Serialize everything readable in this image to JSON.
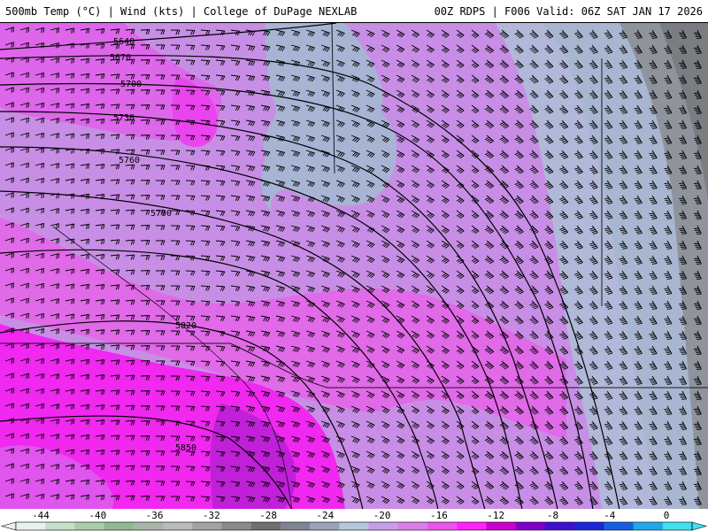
{
  "header": {
    "left_title": "500mb Temp (°C) | Wind (kts) | College of DuPage NEXLAB",
    "right_title": "00Z RDPS | F006 Valid: 06Z SAT JAN 17 2026"
  },
  "map": {
    "variable": "500mb Temp (°C)",
    "overlay": "Wind (kts)",
    "height_contour_labels": [
      "5640",
      "5670",
      "5700",
      "5730",
      "5760",
      "5790",
      "5820",
      "5850"
    ]
  },
  "legend": {
    "tick_labels": [
      "-44",
      "-40",
      "-36",
      "-32",
      "-28",
      "-24",
      "-20",
      "-16",
      "-12",
      "-8",
      "-4",
      "0"
    ],
    "colors": [
      "#e6f2ea",
      "#c6dfc9",
      "#a9cca9",
      "#90b890",
      "#a7b5a7",
      "#b8bcb8",
      "#a3a3a3",
      "#8a8a8a",
      "#6f6f6f",
      "#7e8592",
      "#9aa3b8",
      "#b6c6dc",
      "#c89ce8",
      "#dd7de8",
      "#ee55ee",
      "#ff22ff",
      "#cc00cc",
      "#8000c8",
      "#4010d0",
      "#1c28d8",
      "#1460e0",
      "#20a8e8",
      "#40e0f0"
    ]
  },
  "colors": {
    "deep_magenta": "#ee22ee",
    "magenta": "#e055ee",
    "lavender": "#c88ee6",
    "light_purple": "#b9a2e0",
    "steel_blue": "#a7b4d4",
    "gray": "#909090",
    "contour": "#000000"
  }
}
